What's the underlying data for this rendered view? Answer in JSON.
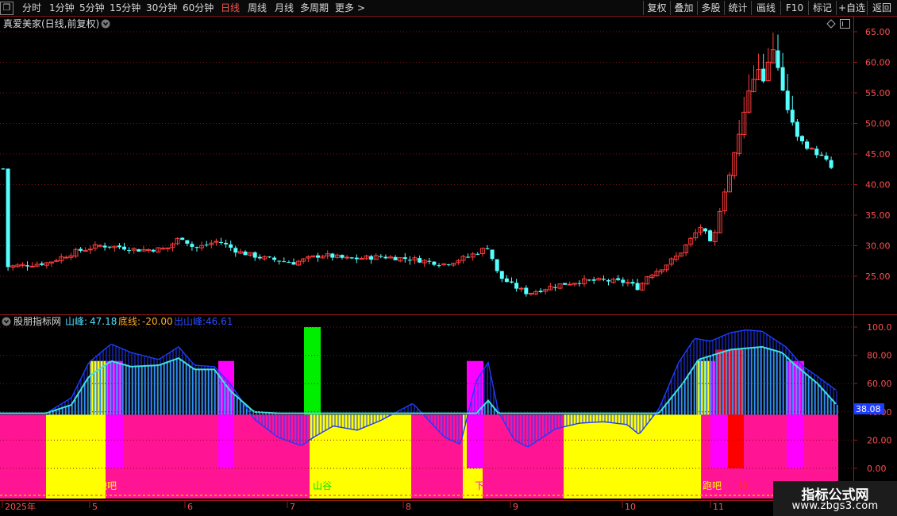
{
  "toolbar": {
    "periods": [
      "分时",
      "1分钟",
      "5分钟",
      "15分钟",
      "30分钟",
      "60分钟",
      "日线",
      "周线",
      "月线",
      "多周期",
      "更多 >"
    ],
    "active_period": "日线",
    "right_buttons": [
      "复权",
      "叠加",
      "多股",
      "统计",
      "画线",
      "F10",
      "标记",
      "+自选",
      "返回"
    ]
  },
  "price_pane": {
    "title": "真爱美家(日线,前复权)",
    "y_ticks": [
      "65.00",
      "60.00",
      "55.00",
      "50.00",
      "45.00",
      "40.00",
      "35.00",
      "30.00",
      "25.00"
    ]
  },
  "indicator_pane": {
    "name": "股朋指标网",
    "shanfeng_label": "山峰:",
    "shanfeng_value": "47.18",
    "dixian_label": "底线:",
    "dixian_value": "-20.00",
    "chushanfeng_label": "出山峰:",
    "chushanfeng_value": "46.61",
    "y_ticks": [
      "100.0",
      "80.00",
      "60.00",
      "40.00",
      "20.00",
      "0.00"
    ],
    "current_value": "38.08",
    "annotations": [
      "跑吧",
      "山谷",
      "下",
      "跑吧",
      "顶"
    ]
  },
  "x_axis": {
    "labels": [
      "2025年",
      "5",
      "6",
      "7",
      "8",
      "9",
      "10",
      "11"
    ]
  },
  "watermark": {
    "line1": "指标公式网",
    "line2": "www.zbgs3.com"
  },
  "colors": {
    "up": "#ff3c3c",
    "down": "#54ffff",
    "magenta": "#ff00ff",
    "pink": "#ff1493",
    "yellow": "#ffff00",
    "green": "#00ee00",
    "red": "#ff0000",
    "blue": "#1e3cff",
    "cyan": "#40e0e0",
    "grid": "#7a1414"
  },
  "chart_data": [
    {
      "type": "candlestick",
      "title": "真爱美家(日线,前复权)",
      "ylim": [
        20,
        66
      ],
      "note_x": "daily bars, approx closes by month",
      "x": [
        "2025-04",
        "2025-05",
        "2025-06",
        "2025-07",
        "2025-08",
        "2025-09",
        "2025-10",
        "2025-11-a",
        "2025-11-b",
        "2025-11-c"
      ],
      "close": [
        27,
        29.5,
        30,
        28,
        28,
        24,
        24.5,
        32,
        62,
        42.5
      ],
      "low": [
        24.5,
        26.5,
        28,
        26.5,
        26.5,
        21.5,
        22.5,
        27,
        45,
        42
      ],
      "high": [
        28,
        31,
        32.5,
        30.5,
        31,
        25.5,
        25.5,
        34,
        65,
        48
      ]
    },
    {
      "type": "bar",
      "title": "股朋指标网",
      "ylim": [
        -20,
        100
      ],
      "series": [
        {
          "name": "山峰",
          "values": [
            47.18
          ]
        },
        {
          "name": "底线",
          "values": [
            -20.0
          ]
        },
        {
          "name": "出山峰",
          "values": [
            46.61
          ]
        }
      ]
    }
  ]
}
